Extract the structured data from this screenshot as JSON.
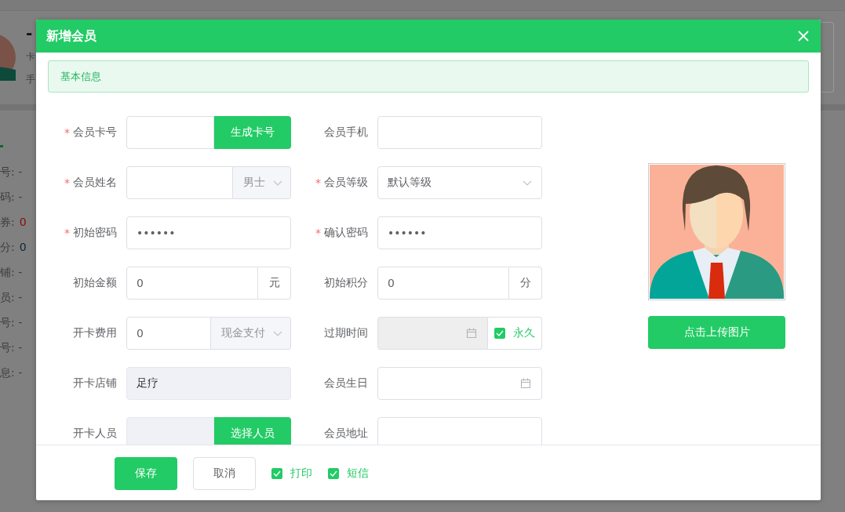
{
  "background": {
    "profile": {
      "name": "-",
      "line_1": "卡",
      "line_2": "手"
    },
    "details": [
      {
        "kind": "text",
        "text": "号: -"
      },
      {
        "kind": "text",
        "text": "码: -"
      },
      {
        "kind": "pair",
        "label": "券:",
        "value": "0",
        "color": "#8a0a0a"
      },
      {
        "kind": "pair",
        "label": "分:",
        "value": "0",
        "color": "#13233a"
      },
      {
        "kind": "text",
        "text": "铺: -"
      },
      {
        "kind": "text",
        "text": "员: -"
      },
      {
        "kind": "text",
        "text": "号: -"
      },
      {
        "kind": "text",
        "text": "号: -"
      },
      {
        "kind": "text",
        "text": "息: -"
      }
    ]
  },
  "dialog": {
    "title": "新增会员",
    "section": "基本信息",
    "fields": [
      {
        "label": "会员卡号",
        "required_mark": "*",
        "kind": "input-button",
        "button": "生成卡号",
        "disabled": false
      },
      {
        "label": "会员手机",
        "kind": "input",
        "disabled": false
      },
      {
        "label": "会员姓名",
        "required_mark": "*",
        "kind": "input-select",
        "option": "男士",
        "disabled": false
      },
      {
        "label": "会员等级",
        "required_mark": "*",
        "kind": "select",
        "value": "默认等级",
        "disabled": false
      },
      {
        "label": "初始密码",
        "required_mark": "*",
        "kind": "input",
        "value": "••••••",
        "disabled": false
      },
      {
        "label": "确认密码",
        "required_mark": "*",
        "kind": "input",
        "value": "••••••",
        "disabled": false
      },
      {
        "label": "初始金额",
        "kind": "input-unit",
        "value": "0",
        "unit": "元",
        "disabled": false
      },
      {
        "label": "初始积分",
        "kind": "input-unit",
        "value": "0",
        "unit": "分",
        "disabled": false
      },
      {
        "label": "开卡费用",
        "kind": "input-select",
        "value": "0",
        "option": "现金支付",
        "disabled": false
      },
      {
        "label": "过期时间",
        "kind": "date",
        "disabled": true,
        "check": {
          "label": "永久",
          "checked": true
        }
      },
      {
        "label": "开卡店铺",
        "kind": "input",
        "value": "足疗",
        "disabled": true
      },
      {
        "label": "会员生日",
        "kind": "date",
        "disabled": false
      },
      {
        "label": "开卡人员",
        "kind": "input-button",
        "button": "选择人员",
        "disabled": true
      },
      {
        "label": "会员地址",
        "kind": "input",
        "disabled": false
      }
    ],
    "upload_button": "点击上传图片",
    "footer": {
      "buttons": [
        {
          "label": "保存",
          "kind": "primary"
        },
        {
          "label": "取消",
          "kind": "default"
        }
      ],
      "options": [
        {
          "label": "打印",
          "checked": true
        },
        {
          "label": "短信",
          "checked": true
        }
      ]
    }
  }
}
